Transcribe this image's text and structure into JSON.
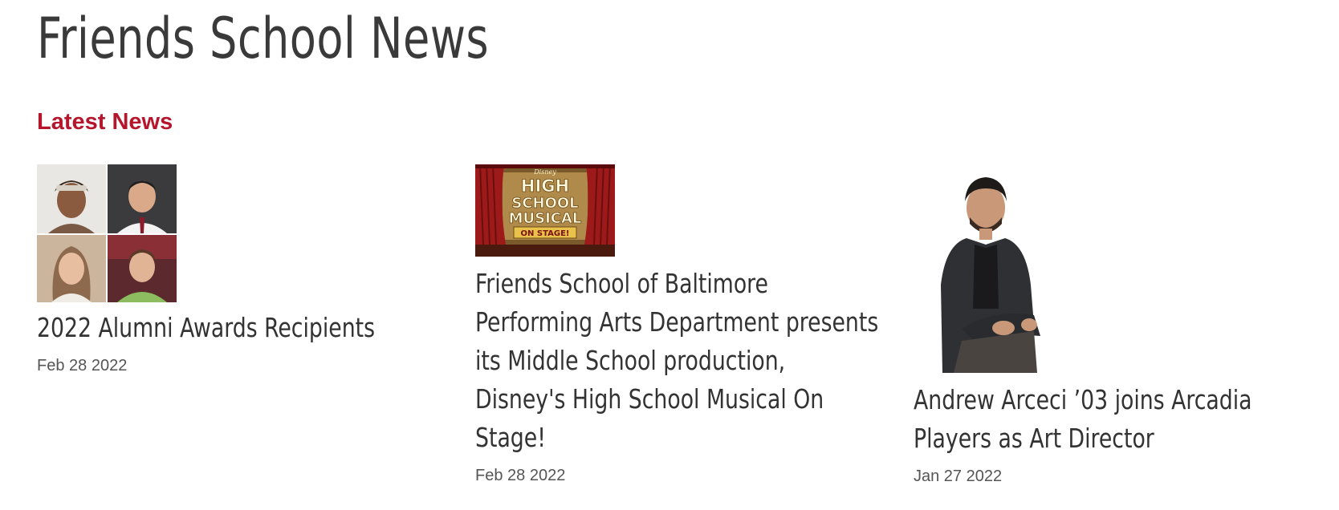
{
  "page": {
    "title": "Friends School News"
  },
  "latest": {
    "heading": "Latest News",
    "articles": [
      {
        "title": "2022 Alumni Awards Recipients",
        "date": "Feb 28 2022",
        "image": "four-portrait-collage"
      },
      {
        "title": "Friends School of Baltimore Performing Arts Department presents its Middle School production, Disney's High School Musical On Stage!",
        "date": "Feb 28 2022",
        "image": "high-school-musical-poster",
        "image_text": {
          "brand": "Disney",
          "line1": "HIGH",
          "line2": "SCHOOL",
          "line3": "MUSICAL",
          "banner": "ON STAGE!"
        }
      },
      {
        "title": "Andrew Arceci ’03 joins Arcadia Players as Art Director",
        "date": "Jan 27 2022",
        "image": "seated-man-portrait"
      }
    ]
  },
  "colors": {
    "accent": "#b5162b",
    "text": "#333333",
    "muted": "#555555"
  }
}
